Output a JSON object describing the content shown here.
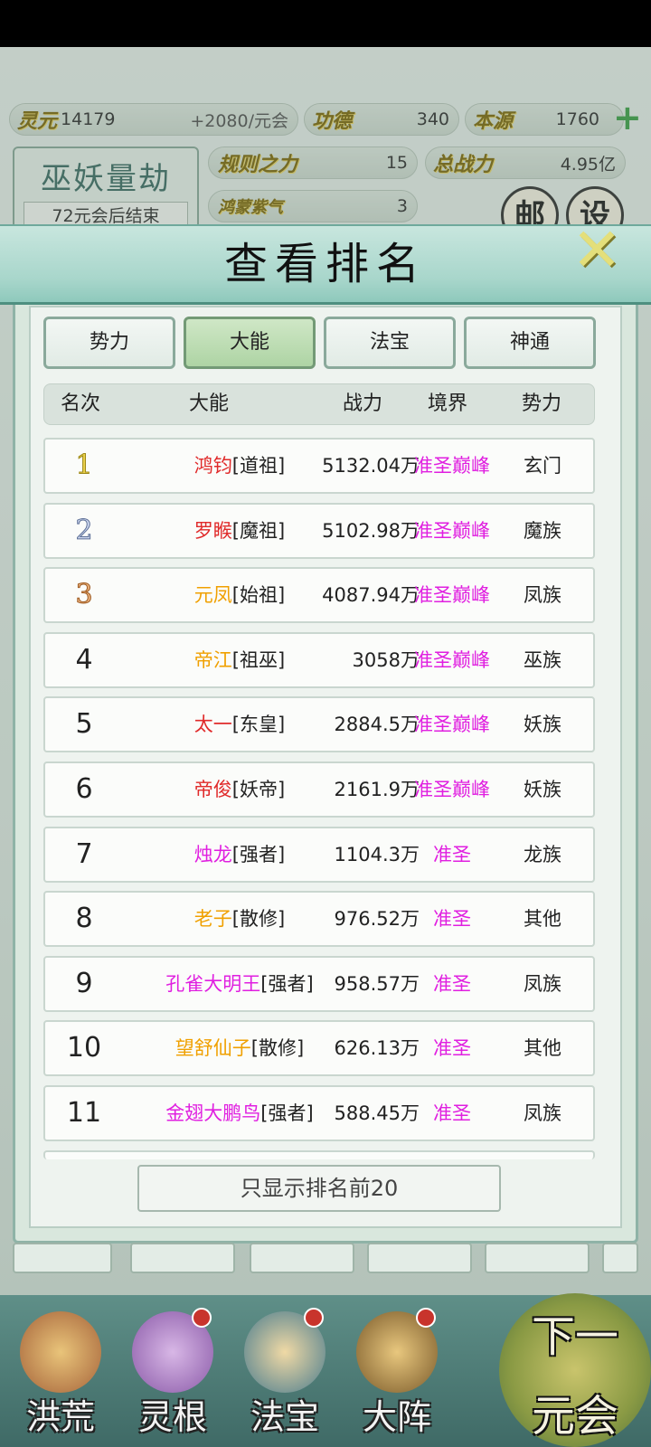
{
  "hud": {
    "lingyuan_label": "灵元",
    "lingyuan_value": "14179",
    "lingyuan_rate": "+2080/元会",
    "gongde_label": "功德",
    "gongde_value": "340",
    "benyuan_label": "本源",
    "benyuan_value": "1760",
    "guize_label": "规则之力",
    "guize_value": "15",
    "zongzhanli_label": "总战力",
    "zongzhanli_value": "4.95亿",
    "hongmeng_label": "鸿蒙紫气",
    "hongmeng_value": "3",
    "kalpa_title": "巫妖量劫",
    "kalpa_sub": "72元会后结束",
    "mail_label": "邮",
    "settings_label": "设"
  },
  "modal": {
    "title": "查看排名",
    "tabs": [
      "势力",
      "大能",
      "法宝",
      "神通"
    ],
    "active_tab": "大能",
    "headers": {
      "rank": "名次",
      "name": "大能",
      "power": "战力",
      "realm": "境界",
      "faction": "势力"
    },
    "rows": [
      {
        "rank": "1",
        "name": "鸿钧",
        "title": "[道祖]",
        "power": "5132.04万",
        "realm": "准圣巅峰",
        "faction": "玄门",
        "name_color": "#e02a2a"
      },
      {
        "rank": "2",
        "name": "罗睺",
        "title": "[魔祖]",
        "power": "5102.98万",
        "realm": "准圣巅峰",
        "faction": "魔族",
        "name_color": "#e02a2a"
      },
      {
        "rank": "3",
        "name": "元凤",
        "title": "[始祖]",
        "power": "4087.94万",
        "realm": "准圣巅峰",
        "faction": "凤族",
        "name_color": "#f0a000"
      },
      {
        "rank": "4",
        "name": "帝江",
        "title": "[祖巫]",
        "power": "3058万",
        "realm": "准圣巅峰",
        "faction": "巫族",
        "name_color": "#f0a000"
      },
      {
        "rank": "5",
        "name": "太一",
        "title": "[东皇]",
        "power": "2884.5万",
        "realm": "准圣巅峰",
        "faction": "妖族",
        "name_color": "#e02a2a"
      },
      {
        "rank": "6",
        "name": "帝俊",
        "title": "[妖帝]",
        "power": "2161.9万",
        "realm": "准圣巅峰",
        "faction": "妖族",
        "name_color": "#e02a2a"
      },
      {
        "rank": "7",
        "name": "烛龙",
        "title": "[强者]",
        "power": "1104.3万",
        "realm": "准圣",
        "faction": "龙族",
        "name_color": "#e01fe0"
      },
      {
        "rank": "8",
        "name": "老子",
        "title": "[散修]",
        "power": "976.52万",
        "realm": "准圣",
        "faction": "其他",
        "name_color": "#f0a000"
      },
      {
        "rank": "9",
        "name": "孔雀大明王",
        "title": "[强者]",
        "power": "958.57万",
        "realm": "准圣",
        "faction": "凤族",
        "name_color": "#e01fe0"
      },
      {
        "rank": "10",
        "name": "望舒仙子",
        "title": "[散修]",
        "power": "626.13万",
        "realm": "准圣",
        "faction": "其他",
        "name_color": "#f0a000"
      },
      {
        "rank": "11",
        "name": "金翅大鹏鸟",
        "title": "[强者]",
        "power": "588.45万",
        "realm": "准圣",
        "faction": "凤族",
        "name_color": "#e01fe0"
      }
    ],
    "only_top_button": "只显示排名前20"
  },
  "nav": {
    "items": [
      "洪荒",
      "灵根",
      "法宝",
      "大阵"
    ],
    "next_line1": "下一",
    "next_line2": "元会"
  }
}
